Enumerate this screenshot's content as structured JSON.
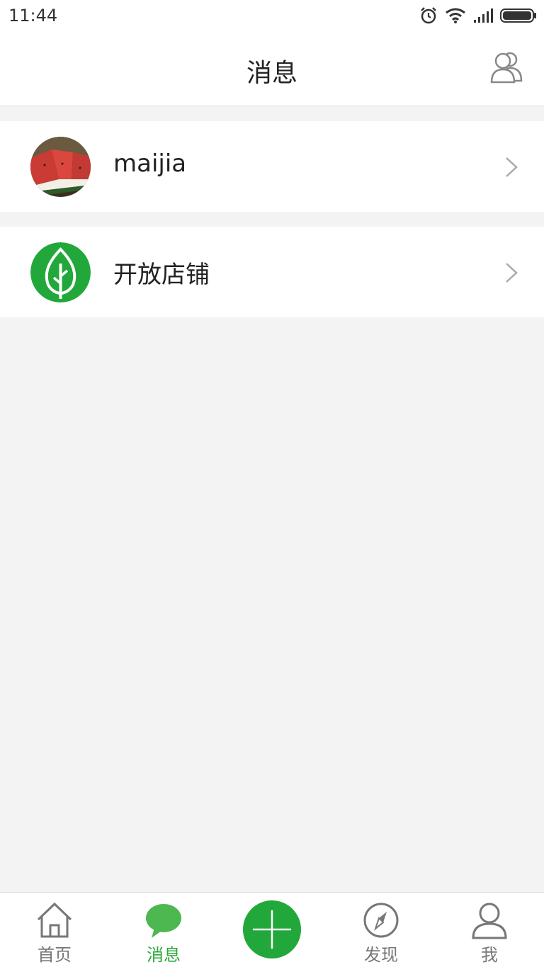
{
  "status_bar": {
    "time": "11:44",
    "icons": [
      "alarm-icon",
      "wifi-icon",
      "signal-icon",
      "battery-icon"
    ]
  },
  "header": {
    "title": "消息",
    "right_icon": "contacts-icon"
  },
  "conversations": [
    {
      "name": "maijia",
      "avatar": "watermelon-photo-avatar"
    },
    {
      "name": "开放店铺",
      "avatar": "green-tree-logo-avatar"
    }
  ],
  "tabbar": {
    "tabs": [
      {
        "label": "首页",
        "icon": "home-icon",
        "active": false
      },
      {
        "label": "消息",
        "icon": "chat-bubble-icon",
        "active": true
      },
      {
        "label": "",
        "icon": "plus-icon",
        "active": false
      },
      {
        "label": "发现",
        "icon": "compass-icon",
        "active": false
      },
      {
        "label": "我",
        "icon": "person-icon",
        "active": false
      }
    ]
  },
  "colors": {
    "accent": "#2aaa3a",
    "background": "#f3f3f3"
  }
}
